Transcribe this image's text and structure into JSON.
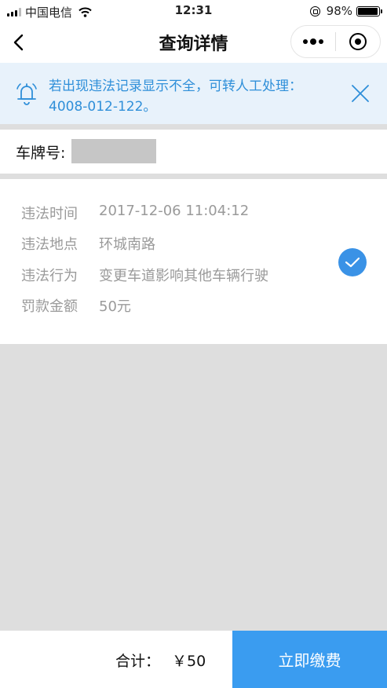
{
  "status_bar": {
    "carrier": "中国电信",
    "time": "12:31",
    "battery": "98%",
    "battery_level": 0.98
  },
  "nav": {
    "title": "查询详情"
  },
  "notice": {
    "text": "若出现违法记录显示不全，可转人工处理：4008-012-122。"
  },
  "plate": {
    "label": "车牌号:"
  },
  "record": {
    "rows": [
      {
        "label": "违法时间",
        "value": "2017-12-06 11:04:12"
      },
      {
        "label": "违法地点",
        "value": "环城南路"
      },
      {
        "label": "违法行为",
        "value": "变更车道影响其他车辆行驶"
      },
      {
        "label": "罚款金额",
        "value": "50元"
      }
    ],
    "selected": true
  },
  "footer": {
    "total_label": "合计：",
    "total_value": "￥50",
    "pay_label": "立即缴费"
  },
  "colors": {
    "accent": "#3a9cf0",
    "notice_text": "#2f8fd9",
    "notice_bg": "#e8f2fb",
    "page_bg": "#dedede"
  }
}
